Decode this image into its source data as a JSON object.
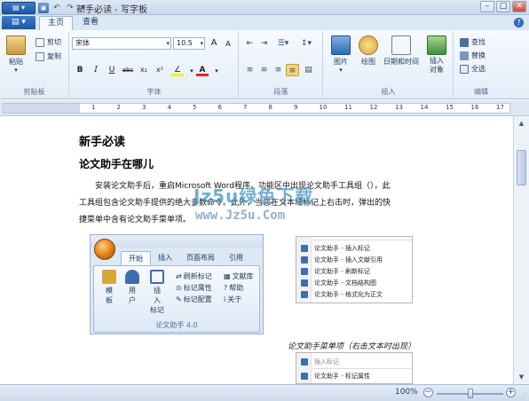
{
  "window": {
    "title": "新手必读 - 写字板",
    "controls": {
      "minimize": "–",
      "maximize": "□",
      "close": "✕"
    }
  },
  "quick_access": {
    "menu_label": "▤ ▾"
  },
  "tabs": [
    {
      "label": "主页",
      "active": true
    },
    {
      "label": "查看",
      "active": false
    }
  ],
  "ribbon": {
    "clipboard": {
      "label": "剪贴板",
      "paste": "粘贴",
      "cut": "剪切",
      "copy": "复制"
    },
    "font": {
      "label": "字体",
      "font_name": "宋体",
      "font_size": "10.5",
      "grow": "A",
      "shrink": "A",
      "bold": "B",
      "italic": "I",
      "underline": "U",
      "strike": "abc",
      "subscript": "x₂",
      "superscript": "x²",
      "highlight": "∠",
      "color": "A"
    },
    "paragraph": {
      "label": "段落"
    },
    "insert": {
      "label": "插入",
      "picture": "图片",
      "paint": "绘图",
      "datetime": "日期和时间",
      "object_line1": "插入",
      "object_line2": "对象"
    },
    "editing": {
      "label": "编辑",
      "find": "查找",
      "replace": "替换",
      "select_all": "全选"
    }
  },
  "ruler": {
    "numbers": [
      "1",
      "2",
      "3",
      "4",
      "5",
      "6",
      "7",
      "8",
      "9",
      "10",
      "11",
      "12",
      "13",
      "14",
      "15",
      "16",
      "17"
    ]
  },
  "document": {
    "heading1": "新手必读",
    "heading2": "论文助手在哪儿",
    "para_line1": "安装论文助手后，重启Microsoft    Word程序，功能区中出现论文助手工具组（），此",
    "para_line2": "工具组包含论文助手提供的绝大多数命令。此外，当您在文本域标记上右击时，弹出的快",
    "para_line3": "捷菜单中含有论文助手菜单项。",
    "watermark_main": "Jz5u绿色下载",
    "watermark_url": "www.Jz5u.Com",
    "caption_right": "论文助手菜单项（右击文本时出现）"
  },
  "embedded_ribbon": {
    "tabs": [
      "开始",
      "插入",
      "页面布局",
      "引用"
    ],
    "buttons": {
      "template_1": "模",
      "template_2": "板",
      "user_1": "用",
      "user_2": "户",
      "insert_1": "插",
      "insert_2": "入",
      "mark": "标记",
      "refresh": "刷新标记",
      "library": "文献库",
      "props": "标记属性",
      "help": "帮助",
      "config": "标记配置",
      "about": "关于"
    },
    "caption": "论文助手 4.0"
  },
  "context_menu": {
    "items": [
      "论文助手 - 插入标记",
      "论文助手 - 插入文献引用",
      "论文助手 - 刷新标记",
      "论文助手 - 文档结构图",
      "论文助手 - 格式化为正文"
    ]
  },
  "context_menu2": {
    "items": [
      "插入标记",
      "论文助手 - 标记属性"
    ]
  },
  "status": {
    "zoom_label": "100%",
    "zoom_value": 0.5,
    "zoom_out": "−",
    "zoom_in": "+",
    "grip": "⋰"
  }
}
